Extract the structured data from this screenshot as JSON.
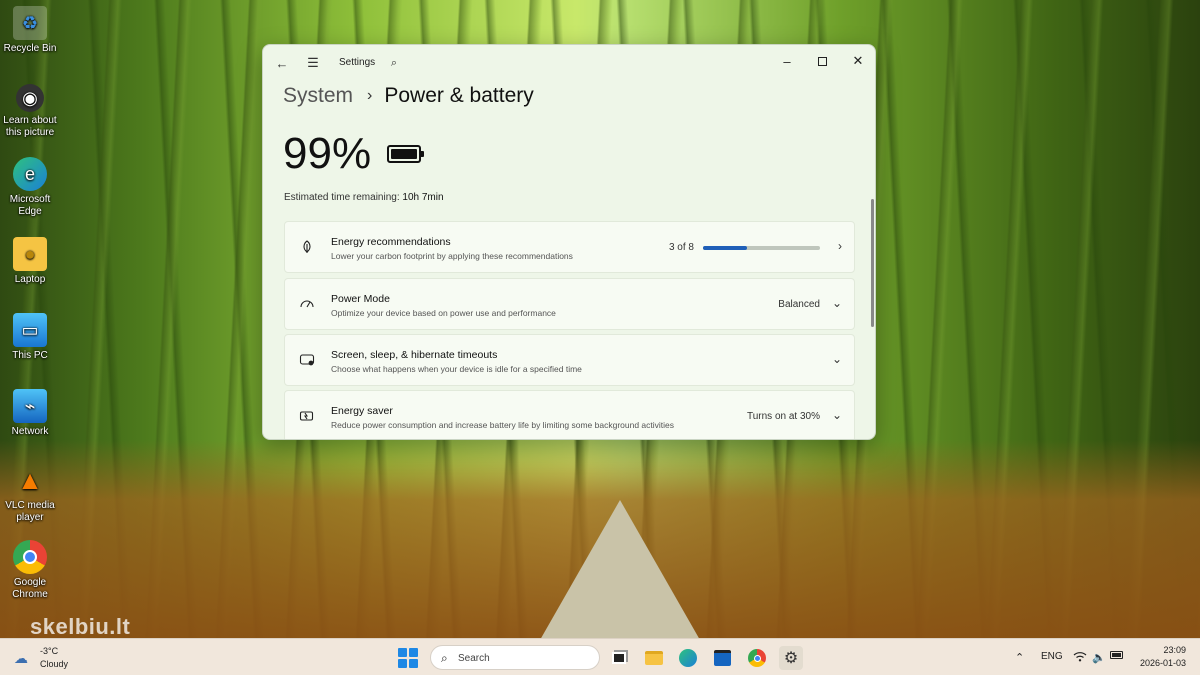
{
  "desktop": {
    "icons": [
      {
        "label": "Recycle Bin",
        "icon": "recycle-bin-icon"
      },
      {
        "label": "Learn about this picture",
        "icon": "camera-icon"
      },
      {
        "label": "Microsoft Edge",
        "icon": "edge-icon"
      },
      {
        "label": "Laptop",
        "icon": "user-folder-icon"
      },
      {
        "label": "This PC",
        "icon": "monitor-icon"
      },
      {
        "label": "Network",
        "icon": "network-icon"
      },
      {
        "label": "VLC media player",
        "icon": "vlc-cone-icon"
      },
      {
        "label": "Google Chrome",
        "icon": "chrome-icon"
      }
    ],
    "watermark": "skelbiu.lt"
  },
  "window": {
    "app_title": "Settings",
    "breadcrumb": {
      "parent": "System",
      "separator": "›",
      "current": "Power & battery"
    },
    "battery": {
      "percent_label": "99%",
      "percent": 99,
      "time_label": "Estimated time remaining:",
      "time_value": "10h 7min"
    },
    "cards": [
      {
        "title": "Energy recommendations",
        "description": "Lower your carbon footprint by applying these recommendations",
        "status": "3 of 8",
        "progress": 0.375,
        "icon": "leaf-icon"
      },
      {
        "title": "Power Mode",
        "description": "Optimize your device based on power use and performance",
        "status": "Balanced",
        "icon": "power-mode-icon"
      },
      {
        "title": "Screen, sleep, & hibernate timeouts",
        "description": "Choose what happens when your device is idle for a specified time",
        "status": "",
        "icon": "screen-sleep-icon"
      },
      {
        "title": "Energy saver",
        "description": "Reduce power consumption and increase battery life by limiting some background activities",
        "status": "Turns on at 30%",
        "icon": "energy-saver-icon"
      }
    ]
  },
  "taskbar": {
    "weather": {
      "temp": "-3°C",
      "condition": "Cloudy"
    },
    "search_placeholder": "Search",
    "language": "ENG",
    "time": "23:09",
    "date": "2026-01-03"
  },
  "colors": {
    "accent": "#1f5fb8",
    "window_bg": "#eef6e8",
    "card_bg": "#f7fbf3",
    "taskbar_bg": "#f1e7dc"
  }
}
